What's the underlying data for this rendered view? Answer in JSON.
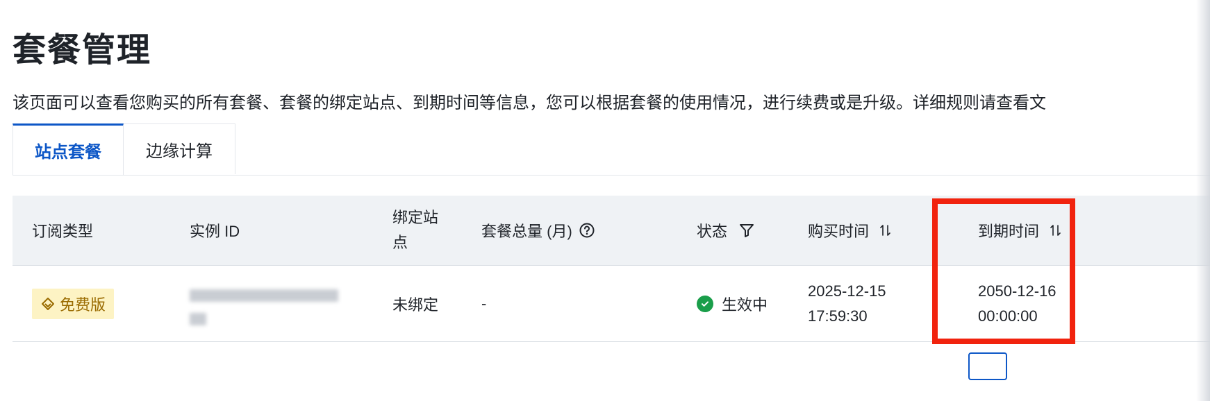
{
  "page": {
    "title": "套餐管理",
    "description": "该页面可以查看您购买的所有套餐、套餐的绑定站点、到期时间等信息，您可以根据套餐的使用情况，进行续费或是升级。详细规则请查看文"
  },
  "tabs": [
    {
      "label": "站点套餐",
      "active": true
    },
    {
      "label": "边缘计算",
      "active": false
    }
  ],
  "table": {
    "columns": {
      "subscription_type": "订阅类型",
      "instance_id": "实例 ID",
      "bound_site": "绑定站点",
      "package_total": "套餐总量 (月)",
      "status": "状态",
      "purchase_time": "购买时间",
      "expire_time": "到期时间"
    },
    "rows": [
      {
        "plan": "免费版",
        "bound_site": "未绑定",
        "package_total": "-",
        "status": "生效中",
        "purchase_date": "2025-12-15",
        "purchase_clock": "17:59:30",
        "expire_date": "2050-12-16",
        "expire_clock": "00:00:00"
      }
    ]
  },
  "colors": {
    "accent": "#0d57c7",
    "highlight": "#f1230e",
    "status_ok": "#1a9e4a",
    "badge_bg": "#fdf3c4",
    "header_bg": "#eff2f5"
  },
  "icons": [
    "help-icon",
    "filter-icon",
    "sort-icon",
    "diamond-icon",
    "check-circle-icon"
  ]
}
